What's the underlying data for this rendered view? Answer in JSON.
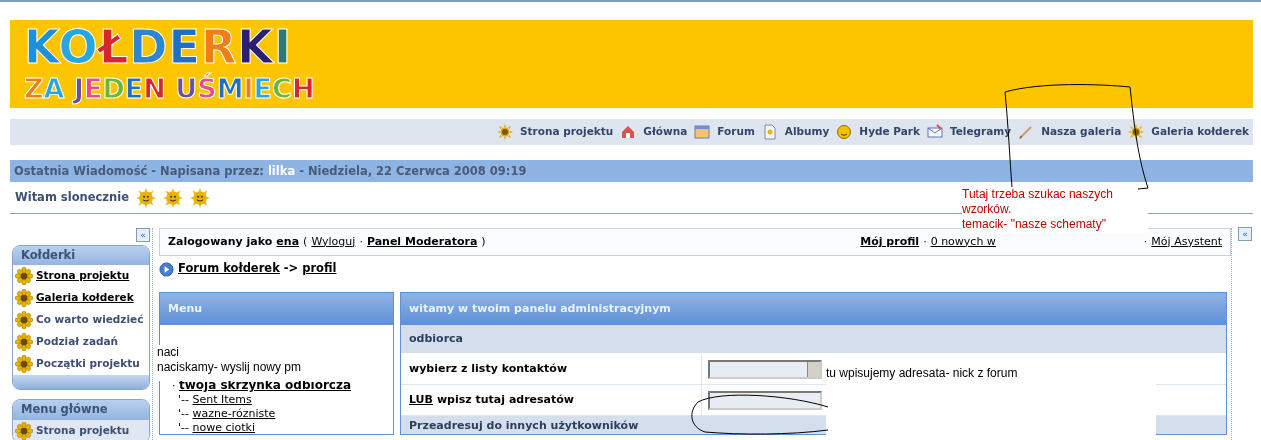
{
  "header": {
    "logo_lines": [
      "KOŁDERKI",
      "ZA JEDEN UŚMIECH"
    ]
  },
  "nav": [
    {
      "label": "Strona projektu",
      "kind": "sun"
    },
    {
      "label": "Główna",
      "kind": "house"
    },
    {
      "label": "Forum",
      "kind": "window"
    },
    {
      "label": "Albumy",
      "kind": "document"
    },
    {
      "label": "Hyde Park",
      "kind": "smiley"
    },
    {
      "label": "Telegramy",
      "kind": "envelope"
    },
    {
      "label": "Nasza galeria",
      "kind": "brush"
    },
    {
      "label": "Galeria kołderek",
      "kind": "sun"
    }
  ],
  "last_message": {
    "prefix": "Ostatnia Wiadomość - Napisana przez:",
    "author": "lilka",
    "date": "- Niedziela, 22 Czerwca 2008 09:19"
  },
  "greeting": {
    "text": "Witam slonecznie"
  },
  "sidebar_boxes": [
    {
      "title": "Kołderki",
      "items": [
        {
          "label": "Strona projektu",
          "underlined": true
        },
        {
          "label": "Galeria kołderek",
          "underlined": true
        },
        {
          "label": "Co warto wiedzieć",
          "underlined": false
        },
        {
          "label": "Podział zadań",
          "underlined": false
        },
        {
          "label": "Początki projektu",
          "underlined": false
        }
      ]
    },
    {
      "title": "Menu główne",
      "items": [
        {
          "label": "Strona projektu",
          "underlined": false
        }
      ]
    }
  ],
  "login_bar": {
    "prefix": "Zalogowany jako",
    "user": "ena",
    "open": "(",
    "logout": "Wyloguj",
    "separator": "·",
    "moderator": "Panel Moderatora",
    "close": ")",
    "links": [
      {
        "label": "Mój profil",
        "bold": true
      },
      {
        "label": "0 nowych w",
        "bold": false
      },
      {
        "label": "Mój Asystent",
        "bold": false
      }
    ]
  },
  "collapse_buttons": [
    "«",
    "«"
  ],
  "breadcrumb": {
    "items": [
      "Forum kołderek",
      "profil"
    ],
    "separator": "->"
  },
  "menu_panel": {
    "title": "Menu",
    "items": [
      {
        "prefix": "·",
        "label": "twoja skrzynka odbiorcza",
        "bold": true
      },
      {
        "prefix": "'--",
        "label": "Sent Items",
        "bold": false
      },
      {
        "prefix": "'--",
        "label": "wazne-rózniste",
        "bold": false
      },
      {
        "prefix": "'--",
        "label": "nowe ciotki",
        "bold": false
      }
    ]
  },
  "admin_panel": {
    "title": "witamy w twoim panelu administracyjnym",
    "section": "odbiorca",
    "rows": [
      {
        "kind": "select",
        "link": "",
        "label": "wybierz z listy kontaktów"
      },
      {
        "kind": "input",
        "link": "LUB",
        "label": "wpisz tutaj adresatów"
      }
    ],
    "next_section": "Przeadresuj do innych użytkowników"
  },
  "annotations": [
    {
      "kind": "red",
      "lines": [
        "Tutaj trzeba szukac naszych",
        "wzorków.",
        "temacik- \"nasze schematy\""
      ]
    },
    {
      "kind": "black",
      "lines": [
        "naci",
        "naciskamy- wyslij nowy pm"
      ]
    },
    {
      "kind": "black",
      "lines": [
        "tu wpisujemy adresata- nick z forum"
      ]
    }
  ]
}
